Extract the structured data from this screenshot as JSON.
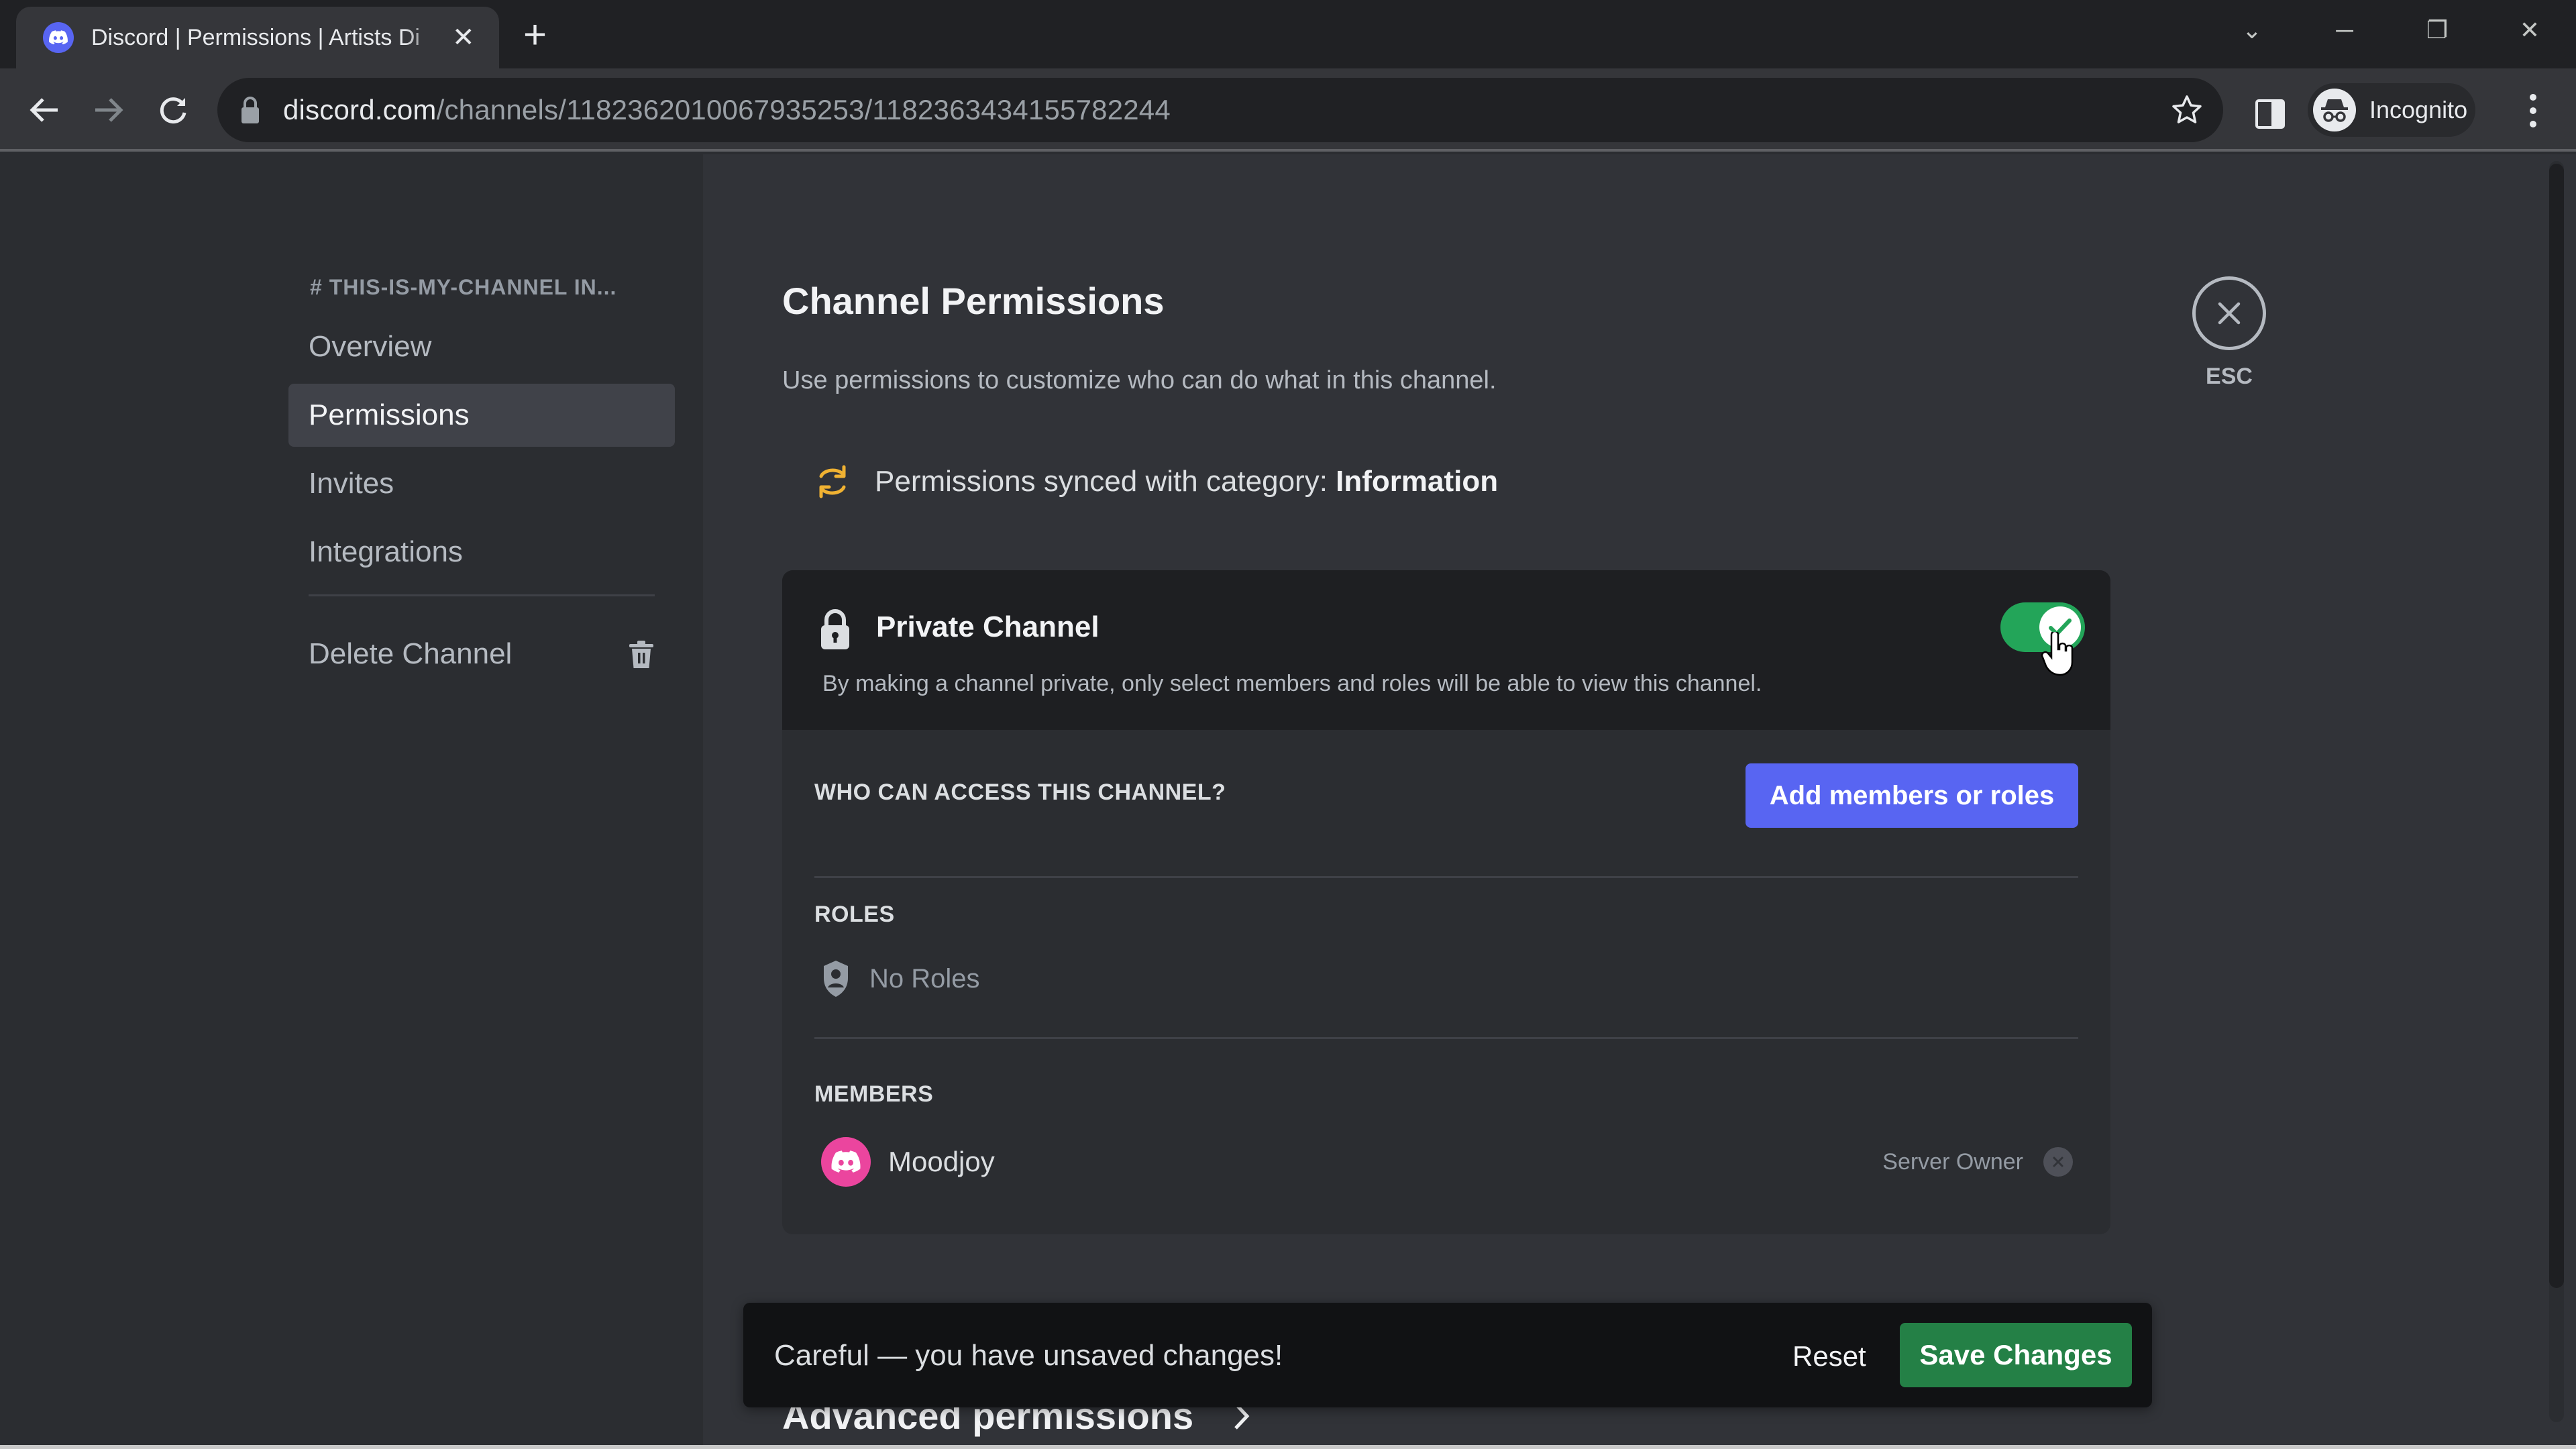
{
  "browser": {
    "tab": {
      "title": "Discord | Permissions | Artists Di",
      "favicon": "discord-icon",
      "close": "✕"
    },
    "new_tab": "+",
    "window_controls": {
      "tab_search": "⌄",
      "minimize": "─",
      "restore": "❐",
      "close": "✕"
    },
    "url": {
      "host": "discord.com",
      "path": "/channels/1182362010067935253/1182363434155782244"
    },
    "incognito_label": "Incognito"
  },
  "sidebar": {
    "channel_header": "# THIS-IS-MY-CHANNEL IN...",
    "items": [
      {
        "label": "Overview",
        "active": false
      },
      {
        "label": "Permissions",
        "active": true
      },
      {
        "label": "Invites",
        "active": false
      },
      {
        "label": "Integrations",
        "active": false
      }
    ],
    "delete_label": "Delete Channel"
  },
  "main": {
    "title": "Channel Permissions",
    "description": "Use permissions to customize who can do what in this channel.",
    "sync": {
      "prefix": "Permissions synced with category: ",
      "category": "Information"
    },
    "esc_label": "ESC",
    "private_channel": {
      "title": "Private Channel",
      "description": "By making a channel private, only select members and roles will be able to view this channel.",
      "enabled": true
    },
    "access": {
      "heading": "WHO CAN ACCESS THIS CHANNEL?",
      "add_button": "Add members or roles",
      "roles_heading": "ROLES",
      "no_roles": "No Roles",
      "members_heading": "MEMBERS",
      "members": [
        {
          "name": "Moodjoy",
          "role": "Server Owner"
        }
      ]
    },
    "unsaved_bar": {
      "message": "Careful — you have unsaved changes!",
      "reset": "Reset",
      "save": "Save Changes"
    },
    "advanced_label": "Advanced permissions"
  },
  "colors": {
    "blurple": "#5865f2",
    "green": "#23a559",
    "save_green": "#248046",
    "avatar_pink": "#eb459e",
    "sync_yellow": "#f0b232"
  }
}
